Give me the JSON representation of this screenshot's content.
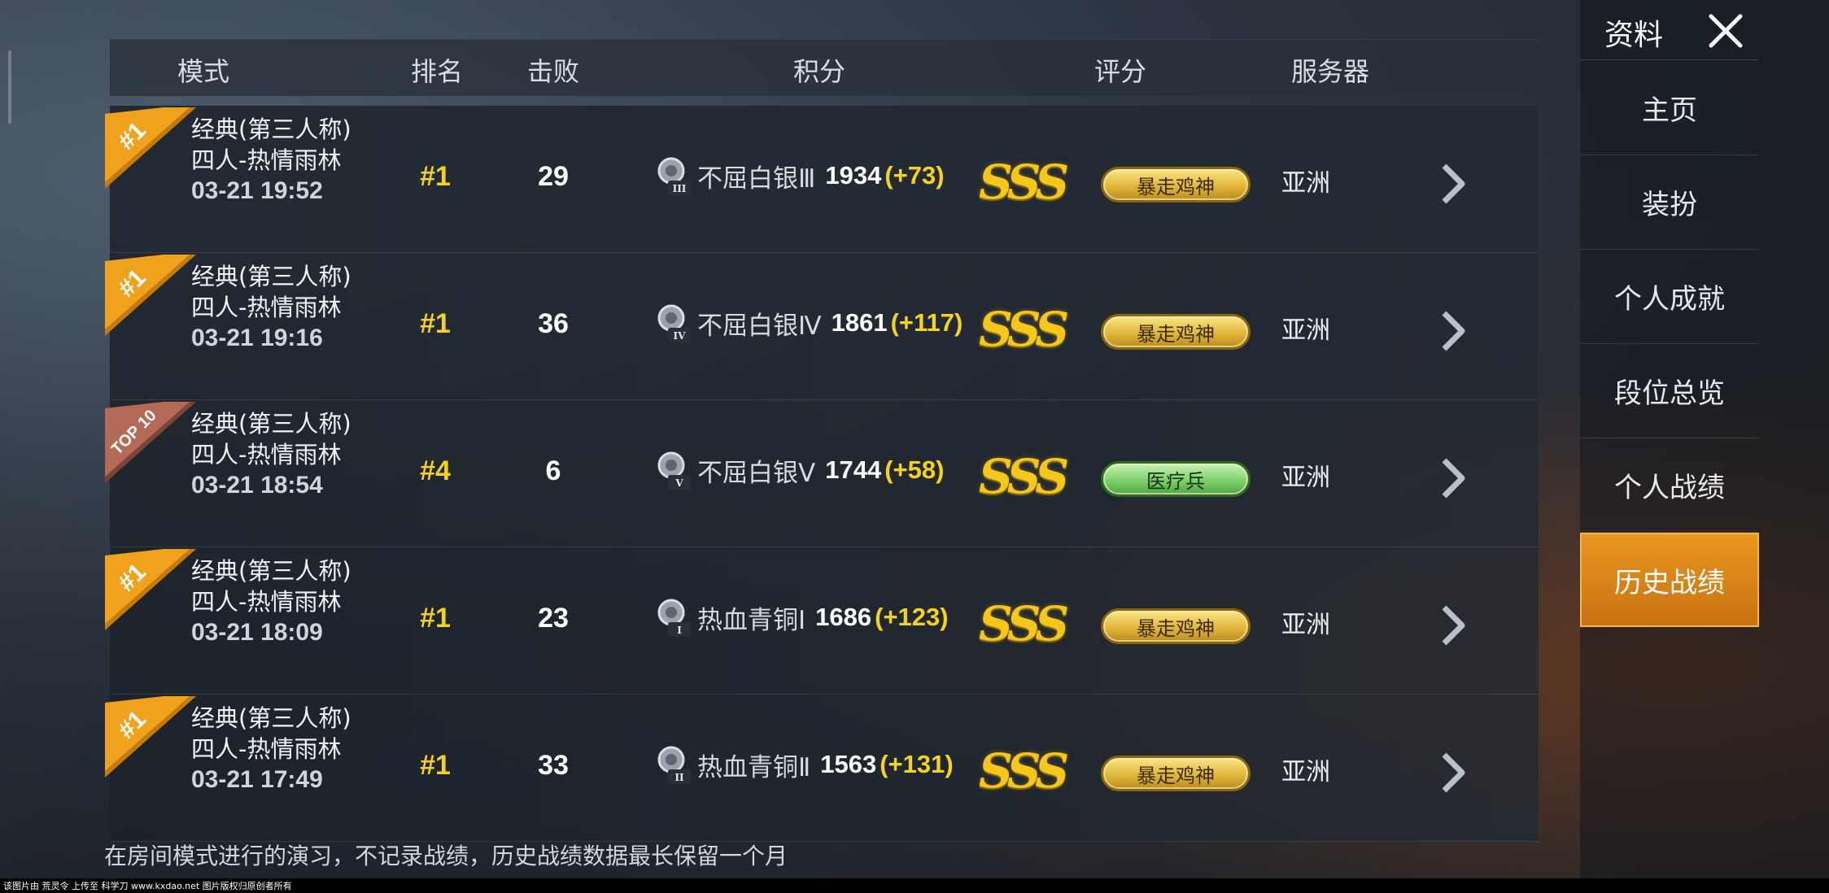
{
  "header": {
    "mode": "模式",
    "rank": "排名",
    "kills": "击败",
    "score": "积分",
    "grade": "评分",
    "server": "服务器"
  },
  "rows": [
    {
      "badge": "#1",
      "badge_type": "gold",
      "mode_line1": "经典(第三人称)",
      "mode_line2": "四人-热情雨林",
      "date": "03-21 19:52",
      "rank": "#1",
      "kills": "29",
      "tier_name": "不屈白银Ⅲ",
      "tier_numeral": "III",
      "score": "1934",
      "delta": "(+73)",
      "grade": "SSS",
      "title": "暴走鸡神",
      "title_style": "gold",
      "server": "亚洲"
    },
    {
      "badge": "#1",
      "badge_type": "gold",
      "mode_line1": "经典(第三人称)",
      "mode_line2": "四人-热情雨林",
      "date": "03-21 19:16",
      "rank": "#1",
      "kills": "36",
      "tier_name": "不屈白银Ⅳ",
      "tier_numeral": "IV",
      "score": "1861",
      "delta": "(+117)",
      "grade": "SSS",
      "title": "暴走鸡神",
      "title_style": "gold",
      "server": "亚洲"
    },
    {
      "badge": "TOP 10",
      "badge_type": "bronze",
      "mode_line1": "经典(第三人称)",
      "mode_line2": "四人-热情雨林",
      "date": "03-21 18:54",
      "rank": "#4",
      "kills": "6",
      "tier_name": "不屈白银Ⅴ",
      "tier_numeral": "V",
      "score": "1744",
      "delta": "(+58)",
      "grade": "SSS",
      "title": "医疗兵",
      "title_style": "green",
      "server": "亚洲"
    },
    {
      "badge": "#1",
      "badge_type": "gold",
      "mode_line1": "经典(第三人称)",
      "mode_line2": "四人-热情雨林",
      "date": "03-21 18:09",
      "rank": "#1",
      "kills": "23",
      "tier_name": "热血青铜Ⅰ",
      "tier_numeral": "I",
      "score": "1686",
      "delta": "(+123)",
      "grade": "SSS",
      "title": "暴走鸡神",
      "title_style": "gold",
      "server": "亚洲"
    },
    {
      "badge": "#1",
      "badge_type": "gold",
      "mode_line1": "经典(第三人称)",
      "mode_line2": "四人-热情雨林",
      "date": "03-21 17:49",
      "rank": "#1",
      "kills": "33",
      "tier_name": "热血青铜Ⅱ",
      "tier_numeral": "II",
      "score": "1563",
      "delta": "(+131)",
      "grade": "SSS",
      "title": "暴走鸡神",
      "title_style": "gold",
      "server": "亚洲"
    }
  ],
  "footnote": "在房间模式进行的演习，不记录战绩，历史战绩数据最长保留一个月",
  "sidebar": {
    "title": "资料",
    "items": [
      {
        "label": "主页",
        "active": false
      },
      {
        "label": "装扮",
        "active": false
      },
      {
        "label": "个人成就",
        "active": false
      },
      {
        "label": "段位总览",
        "active": false
      },
      {
        "label": "个人战绩",
        "active": false
      },
      {
        "label": "历史战绩",
        "active": true
      }
    ]
  },
  "watermark": "该图片由 荒灵令 上传至 科学刀 www.kxdao.net 图片版权归原创者所有",
  "colors": {
    "accent_gold": "#f4d21f",
    "active_tab": "#e08a1a",
    "title_gold": "#e2b73b",
    "title_green": "#7fd06b"
  }
}
